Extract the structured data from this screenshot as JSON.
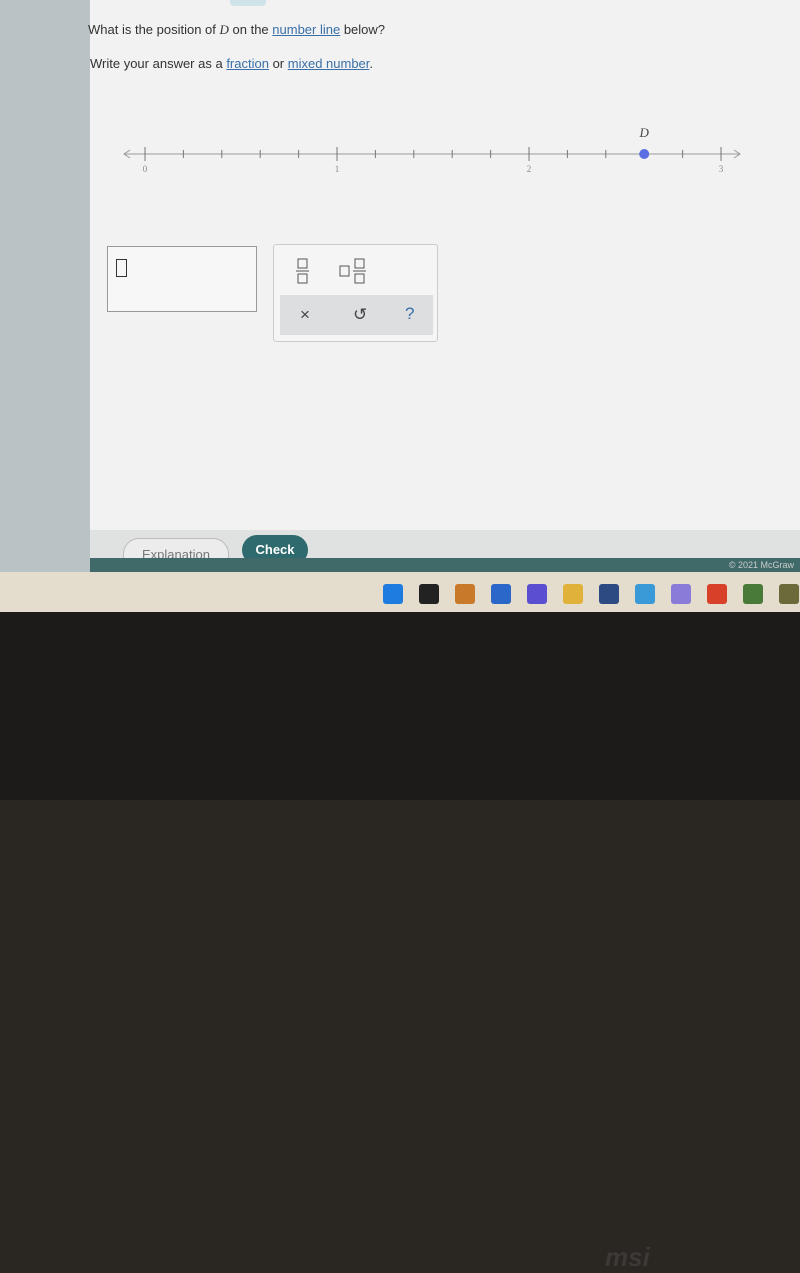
{
  "question": {
    "prefix": "What is the position of ",
    "var": "D",
    "mid": " on the ",
    "link": "number line",
    "suffix": " below?"
  },
  "instruction": {
    "prefix": "Write your answer as a ",
    "link1": "fraction",
    "mid": " or ",
    "link2": "mixed number",
    "suffix": "."
  },
  "number_line": {
    "point_label": "D",
    "point_value": 2.6,
    "min": 0,
    "max": 3,
    "subdivisions_per_unit": 5,
    "tick_labels": [
      "0",
      "1",
      "2",
      "3"
    ],
    "point_color": "#5b6ee1"
  },
  "answer_input": {
    "value": ""
  },
  "keypad": {
    "fraction": "fraction-icon",
    "mixed": "mixed-number-icon",
    "clear": "×",
    "undo": "↺",
    "help": "?"
  },
  "footer": {
    "explanation": "Explanation",
    "check": "Check",
    "copyright": "© 2021 McGraw"
  },
  "taskbar": {
    "icons": [
      "windows-icon",
      "search-icon",
      "task-view-icon",
      "widgets-icon",
      "chat-icon",
      "file-explorer-icon",
      "store-icon",
      "mail-icon",
      "app-icon",
      "office-icon",
      "xbox-icon",
      "app-icon"
    ]
  },
  "bezel": {
    "brand": "msi"
  }
}
